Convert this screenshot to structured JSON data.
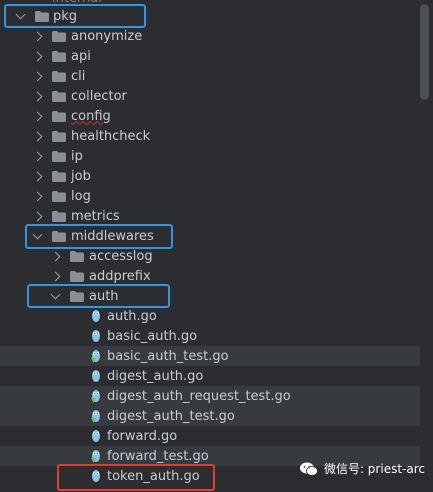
{
  "tree": {
    "top_partial": "internal",
    "pkg": "pkg",
    "folders": [
      "anonymize",
      "api",
      "cli",
      "collector",
      "config",
      "healthcheck",
      "ip",
      "job",
      "log",
      "metrics"
    ],
    "middlewares": "middlewares",
    "sub_folders": [
      "accesslog",
      "addprefix"
    ],
    "auth": "auth",
    "files": [
      {
        "name": "auth.go",
        "test": false
      },
      {
        "name": "basic_auth.go",
        "test": false
      },
      {
        "name": "basic_auth_test.go",
        "test": true
      },
      {
        "name": "digest_auth.go",
        "test": false
      },
      {
        "name": "digest_auth_request_test.go",
        "test": true
      },
      {
        "name": "digest_auth_test.go",
        "test": true
      },
      {
        "name": "forward.go",
        "test": false
      },
      {
        "name": "forward_test.go",
        "test": true
      },
      {
        "name": "token_auth.go",
        "test": false
      }
    ]
  },
  "watermark": {
    "text": "微信号: priest-arc",
    "icon": "wechat-icon"
  },
  "colors": {
    "background": "#2b2d30",
    "test_row": "#373a3e",
    "highlight_blue": "#2f95e6",
    "highlight_red": "#e53a2c",
    "folder": "#8a8f96",
    "go_file": "#86c5e8"
  }
}
